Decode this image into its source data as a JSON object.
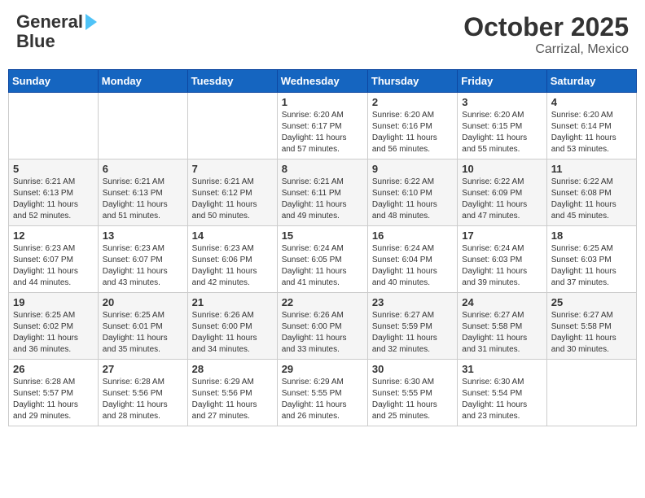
{
  "header": {
    "logo_general": "General",
    "logo_blue": "Blue",
    "month_year": "October 2025",
    "location": "Carrizal, Mexico"
  },
  "weekdays": [
    "Sunday",
    "Monday",
    "Tuesday",
    "Wednesday",
    "Thursday",
    "Friday",
    "Saturday"
  ],
  "weeks": [
    [
      {
        "day": "",
        "info": ""
      },
      {
        "day": "",
        "info": ""
      },
      {
        "day": "",
        "info": ""
      },
      {
        "day": "1",
        "info": "Sunrise: 6:20 AM\nSunset: 6:17 PM\nDaylight: 11 hours\nand 57 minutes."
      },
      {
        "day": "2",
        "info": "Sunrise: 6:20 AM\nSunset: 6:16 PM\nDaylight: 11 hours\nand 56 minutes."
      },
      {
        "day": "3",
        "info": "Sunrise: 6:20 AM\nSunset: 6:15 PM\nDaylight: 11 hours\nand 55 minutes."
      },
      {
        "day": "4",
        "info": "Sunrise: 6:20 AM\nSunset: 6:14 PM\nDaylight: 11 hours\nand 53 minutes."
      }
    ],
    [
      {
        "day": "5",
        "info": "Sunrise: 6:21 AM\nSunset: 6:13 PM\nDaylight: 11 hours\nand 52 minutes."
      },
      {
        "day": "6",
        "info": "Sunrise: 6:21 AM\nSunset: 6:13 PM\nDaylight: 11 hours\nand 51 minutes."
      },
      {
        "day": "7",
        "info": "Sunrise: 6:21 AM\nSunset: 6:12 PM\nDaylight: 11 hours\nand 50 minutes."
      },
      {
        "day": "8",
        "info": "Sunrise: 6:21 AM\nSunset: 6:11 PM\nDaylight: 11 hours\nand 49 minutes."
      },
      {
        "day": "9",
        "info": "Sunrise: 6:22 AM\nSunset: 6:10 PM\nDaylight: 11 hours\nand 48 minutes."
      },
      {
        "day": "10",
        "info": "Sunrise: 6:22 AM\nSunset: 6:09 PM\nDaylight: 11 hours\nand 47 minutes."
      },
      {
        "day": "11",
        "info": "Sunrise: 6:22 AM\nSunset: 6:08 PM\nDaylight: 11 hours\nand 45 minutes."
      }
    ],
    [
      {
        "day": "12",
        "info": "Sunrise: 6:23 AM\nSunset: 6:07 PM\nDaylight: 11 hours\nand 44 minutes."
      },
      {
        "day": "13",
        "info": "Sunrise: 6:23 AM\nSunset: 6:07 PM\nDaylight: 11 hours\nand 43 minutes."
      },
      {
        "day": "14",
        "info": "Sunrise: 6:23 AM\nSunset: 6:06 PM\nDaylight: 11 hours\nand 42 minutes."
      },
      {
        "day": "15",
        "info": "Sunrise: 6:24 AM\nSunset: 6:05 PM\nDaylight: 11 hours\nand 41 minutes."
      },
      {
        "day": "16",
        "info": "Sunrise: 6:24 AM\nSunset: 6:04 PM\nDaylight: 11 hours\nand 40 minutes."
      },
      {
        "day": "17",
        "info": "Sunrise: 6:24 AM\nSunset: 6:03 PM\nDaylight: 11 hours\nand 39 minutes."
      },
      {
        "day": "18",
        "info": "Sunrise: 6:25 AM\nSunset: 6:03 PM\nDaylight: 11 hours\nand 37 minutes."
      }
    ],
    [
      {
        "day": "19",
        "info": "Sunrise: 6:25 AM\nSunset: 6:02 PM\nDaylight: 11 hours\nand 36 minutes."
      },
      {
        "day": "20",
        "info": "Sunrise: 6:25 AM\nSunset: 6:01 PM\nDaylight: 11 hours\nand 35 minutes."
      },
      {
        "day": "21",
        "info": "Sunrise: 6:26 AM\nSunset: 6:00 PM\nDaylight: 11 hours\nand 34 minutes."
      },
      {
        "day": "22",
        "info": "Sunrise: 6:26 AM\nSunset: 6:00 PM\nDaylight: 11 hours\nand 33 minutes."
      },
      {
        "day": "23",
        "info": "Sunrise: 6:27 AM\nSunset: 5:59 PM\nDaylight: 11 hours\nand 32 minutes."
      },
      {
        "day": "24",
        "info": "Sunrise: 6:27 AM\nSunset: 5:58 PM\nDaylight: 11 hours\nand 31 minutes."
      },
      {
        "day": "25",
        "info": "Sunrise: 6:27 AM\nSunset: 5:58 PM\nDaylight: 11 hours\nand 30 minutes."
      }
    ],
    [
      {
        "day": "26",
        "info": "Sunrise: 6:28 AM\nSunset: 5:57 PM\nDaylight: 11 hours\nand 29 minutes."
      },
      {
        "day": "27",
        "info": "Sunrise: 6:28 AM\nSunset: 5:56 PM\nDaylight: 11 hours\nand 28 minutes."
      },
      {
        "day": "28",
        "info": "Sunrise: 6:29 AM\nSunset: 5:56 PM\nDaylight: 11 hours\nand 27 minutes."
      },
      {
        "day": "29",
        "info": "Sunrise: 6:29 AM\nSunset: 5:55 PM\nDaylight: 11 hours\nand 26 minutes."
      },
      {
        "day": "30",
        "info": "Sunrise: 6:30 AM\nSunset: 5:55 PM\nDaylight: 11 hours\nand 25 minutes."
      },
      {
        "day": "31",
        "info": "Sunrise: 6:30 AM\nSunset: 5:54 PM\nDaylight: 11 hours\nand 23 minutes."
      },
      {
        "day": "",
        "info": ""
      }
    ]
  ]
}
